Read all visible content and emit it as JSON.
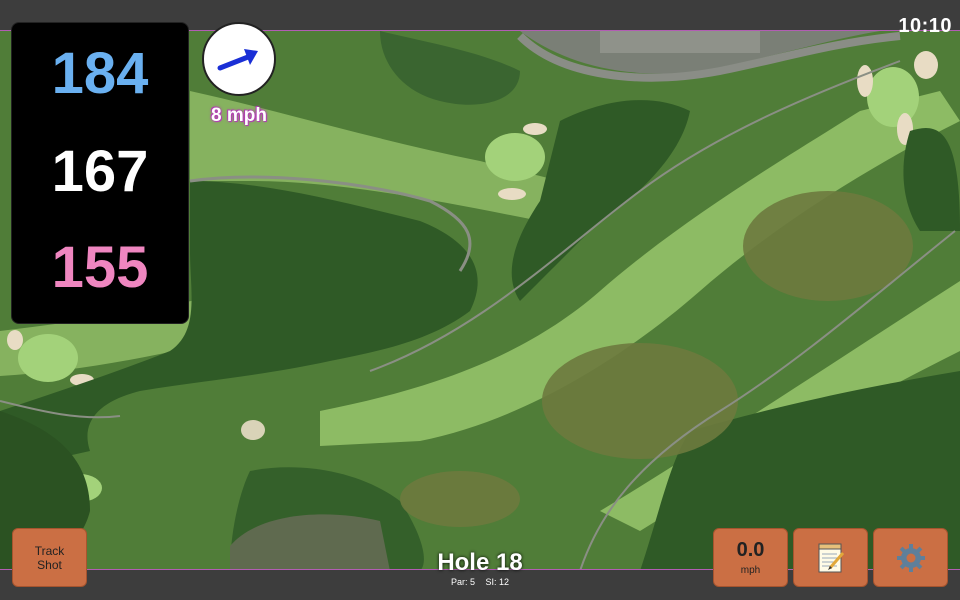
{
  "status": {
    "clock": "10:10"
  },
  "yardages": {
    "back": "184",
    "middle": "167",
    "front": "155"
  },
  "wind": {
    "speed_label": "8 mph",
    "direction_icon": "wind-arrow-icon"
  },
  "buttons": {
    "track_shot_line1": "Track",
    "track_shot_line2": "Shot",
    "speed_value": "0.0",
    "speed_unit": "mph",
    "scorecard_icon": "notepad-icon",
    "settings_icon": "gear-icon"
  },
  "hole": {
    "title": "Hole 18",
    "par": "Par: 5",
    "stroke_index": "SI: 12"
  },
  "colors": {
    "back_yardage": "#6ab0f0",
    "middle_yardage": "#ffffff",
    "front_yardage": "#ef86c0",
    "button_orange": "#cb6f44",
    "accent_purple": "#b23fb3"
  }
}
